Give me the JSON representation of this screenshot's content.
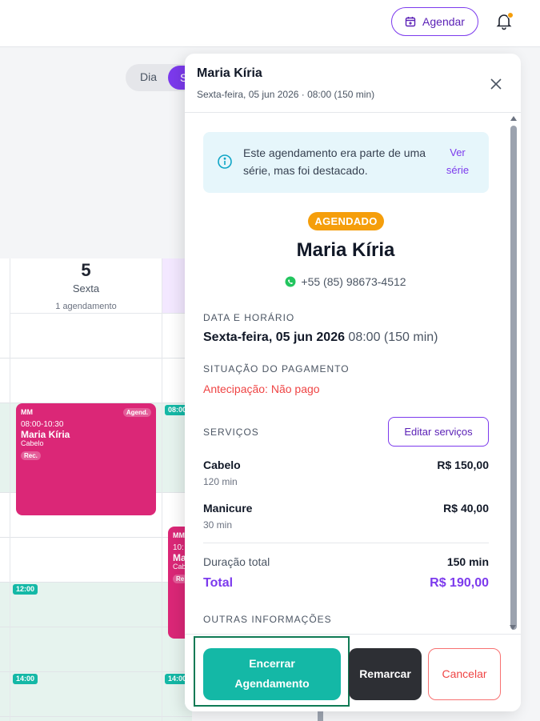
{
  "topbar": {
    "agendar_label": "Agendar",
    "bell_icon": "bell-icon",
    "calendar_icon": "calendar-plus-icon"
  },
  "calendar": {
    "view_dia": "Dia",
    "view_active": "S",
    "day_number": "5",
    "day_name": "Sexta",
    "day_count": "1 agendamento",
    "time_chips": [
      "08:00",
      "12:00",
      "14:00",
      "14:00"
    ],
    "event_main": {
      "initials": "MM",
      "tag": "Agend.",
      "time": "08:00-10:30",
      "name": "Maria Kíria",
      "service": "Cabelo",
      "rec": "Rec."
    },
    "event_second": {
      "initials": "MM",
      "time": "10:",
      "name": "Ma",
      "service": "Cab",
      "rec": "Re"
    }
  },
  "panel": {
    "title": "Maria Kíria",
    "subtitle": "Sexta-feira, 05 jun 2026 · 08:00 (150 min)",
    "info_text": "Este agendamento era parte de uma série, mas foi destacado.",
    "info_link": "Ver série",
    "status_badge": "AGENDADO",
    "client_name": "Maria Kíria",
    "phone": "+55 (85) 98673-4512",
    "date_label": "DATA E HORÁRIO",
    "date_bold": "Sexta-feira, 05 jun 2026",
    "date_rest": " 08:00 (150 min)",
    "payment_label": "SITUAÇÃO DO PAGAMENTO",
    "payment_status": "Antecipação: Não pago",
    "services_label": "SERVIÇOS",
    "edit_services": "Editar serviços",
    "services": [
      {
        "name": "Cabelo",
        "duration": "120 min",
        "price": "R$ 150,00"
      },
      {
        "name": "Manicure",
        "duration": "30 min",
        "price": "R$ 40,00"
      }
    ],
    "duration_label": "Duração total",
    "duration_value": "150 min",
    "total_label": "Total",
    "total_value": "R$ 190,00",
    "other_label": "OUTRAS INFORMAÇÕES"
  },
  "footer": {
    "encerrar_line1": "Encerrar",
    "encerrar_line2": "Agendamento",
    "remarcar": "Remarcar",
    "cancelar": "Cancelar"
  },
  "colors": {
    "accent": "#7c3aed",
    "teal": "#14b8a6",
    "event": "#db2777",
    "badge": "#f59e0b",
    "danger": "#ef4444"
  }
}
